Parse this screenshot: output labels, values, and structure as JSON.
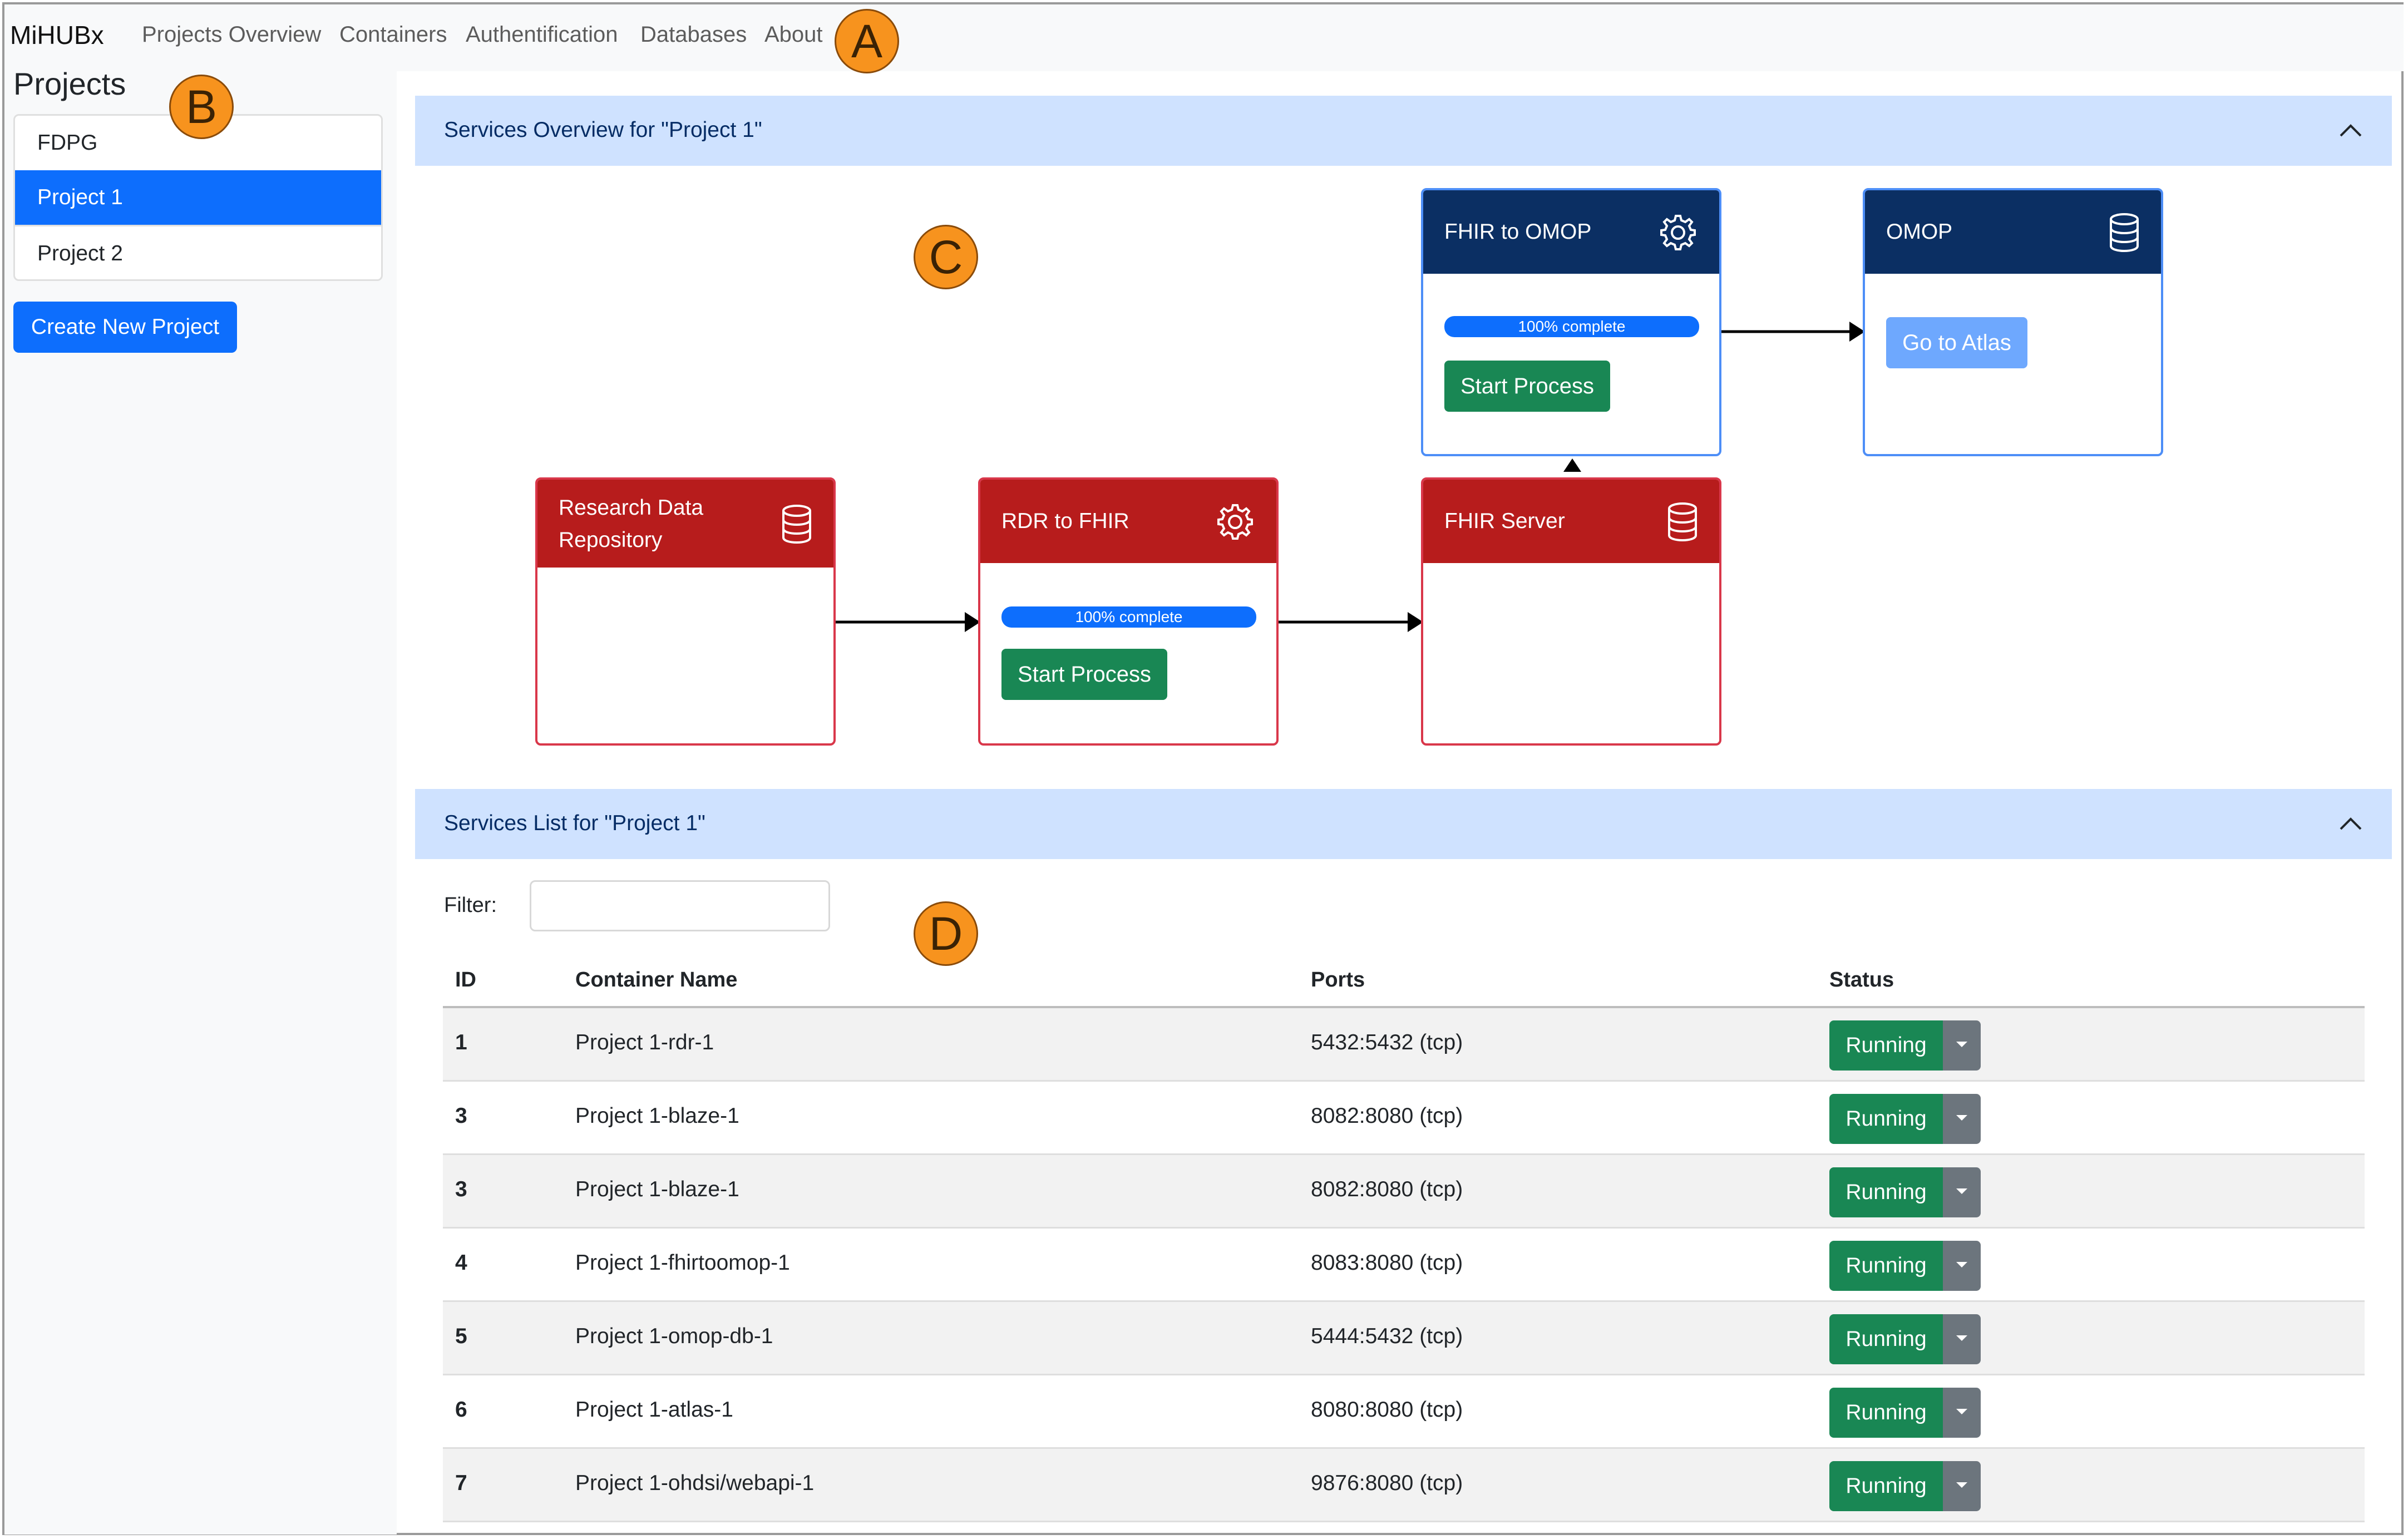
{
  "navbar": {
    "brand": "MiHUBx",
    "links": [
      "Projects Overview",
      "Containers",
      "Authentification",
      "Databases",
      "About"
    ]
  },
  "sidebar": {
    "title": "Projects",
    "projects": [
      "FDPG",
      "Project 1",
      "Project 2"
    ],
    "active_project": "Project 1",
    "create_button": "Create New Project"
  },
  "overview": {
    "title": "Services Overview for \"Project 1\"",
    "cards": {
      "rdr": {
        "title_line1": "Research Data",
        "title_line2": "Repository",
        "icon": "database-icon"
      },
      "rdr_to_fhir": {
        "title": "RDR to FHIR",
        "icon": "gear-icon",
        "progress": "100% complete",
        "progress_value": 100,
        "button": "Start Process"
      },
      "fhir_server": {
        "title": "FHIR Server",
        "icon": "database-icon"
      },
      "fhir_to_omop": {
        "title": "FHIR to OMOP",
        "icon": "gear-icon",
        "progress": "100% complete",
        "progress_value": 100,
        "button": "Start Process"
      },
      "omop": {
        "title": "OMOP",
        "icon": "database-icon",
        "button": "Go to Atlas"
      }
    }
  },
  "services_list": {
    "title": "Services List for \"Project 1\"",
    "filter_label": "Filter:",
    "filter_value": "",
    "columns": [
      "ID",
      "Container Name",
      "Ports",
      "Status"
    ],
    "rows": [
      {
        "id": "1",
        "name": "Project 1-rdr-1",
        "ports": "5432:5432 (tcp)",
        "status": "Running"
      },
      {
        "id": "3",
        "name": "Project 1-blaze-1",
        "ports": "8082:8080 (tcp)",
        "status": "Running"
      },
      {
        "id": "3",
        "name": "Project 1-blaze-1",
        "ports": "8082:8080 (tcp)",
        "status": "Running"
      },
      {
        "id": "4",
        "name": "Project 1-fhirtoomop-1",
        "ports": "8083:8080 (tcp)",
        "status": "Running"
      },
      {
        "id": "5",
        "name": "Project 1-omop-db-1",
        "ports": "5444:5432 (tcp)",
        "status": "Running"
      },
      {
        "id": "6",
        "name": "Project 1-atlas-1",
        "ports": "8080:8080 (tcp)",
        "status": "Running"
      },
      {
        "id": "7",
        "name": "Project 1-ohdsi/webapi-1",
        "ports": "9876:8080 (tcp)",
        "status": "Running"
      }
    ]
  },
  "markers": {
    "a": "A",
    "b": "B",
    "c": "C",
    "d": "D"
  },
  "colors": {
    "primary": "#0d6efd",
    "success": "#198754",
    "danger_header": "#b71c1c",
    "navy_header": "#0b2f63",
    "panel_header": "#cfe2ff",
    "marker": "#f7931e"
  }
}
